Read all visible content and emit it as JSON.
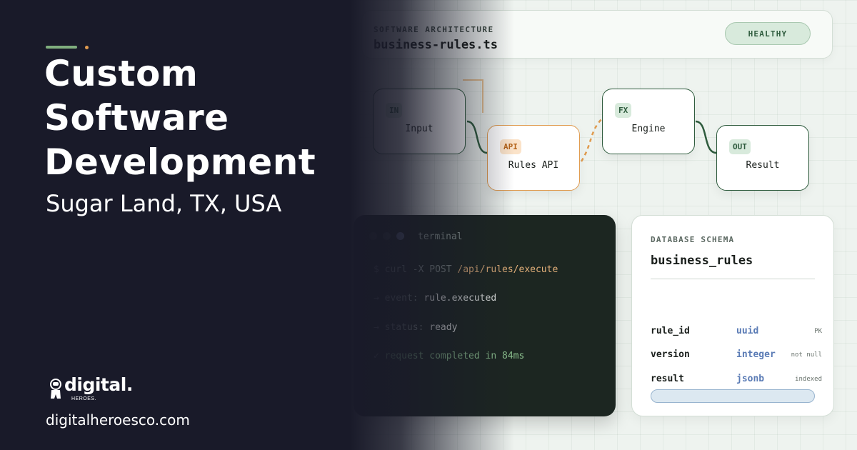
{
  "colors": {
    "dark_bg": "#191a29",
    "brand_green": "#2f5c3e",
    "accent_orange": "#e09b4f",
    "light_bg": "#eef3ef"
  },
  "hero": {
    "title_lines": [
      "Custom",
      "Software",
      "Development"
    ],
    "location": "Sugar Land, TX, USA",
    "logo_word": "digital.",
    "logo_sub": "HEROES.",
    "website": "digitalheroesco.com"
  },
  "header": {
    "section_label": "SOFTWARE ARCHITECTURE",
    "file_name": "business-rules.ts",
    "status": "HEALTHY"
  },
  "flow": {
    "nodes": [
      {
        "badge": "IN",
        "label": "Input"
      },
      {
        "badge": "API",
        "label": "Rules API"
      },
      {
        "badge": "FX",
        "label": "Engine"
      },
      {
        "badge": "OUT",
        "label": "Result"
      }
    ]
  },
  "terminal": {
    "title": "terminal",
    "lines": [
      {
        "prefix": "$ curl -X POST ",
        "value": "/api/rules/execute"
      },
      {
        "prefix": "→ event: ",
        "value": "rule.executed"
      },
      {
        "prefix": "→ status: ",
        "value": "ready"
      },
      {
        "prefix": "✓ ",
        "value": "request completed in 84ms"
      }
    ]
  },
  "schema": {
    "section_label": "DATABASE SCHEMA",
    "table_name": "business_rules",
    "rows": [
      {
        "column": "rule_id",
        "type": "uuid",
        "key": "PK"
      },
      {
        "column": "version",
        "type": "integer",
        "key": "not null"
      },
      {
        "column": "result",
        "type": "jsonb",
        "key": "indexed"
      }
    ]
  },
  "icons": [
    "astronaut-logo-icon",
    "window-dot-icon"
  ]
}
